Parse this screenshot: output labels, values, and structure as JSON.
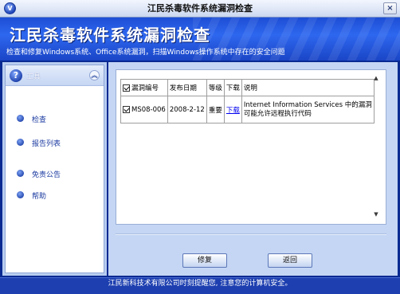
{
  "window": {
    "title": "江民杀毒软件系统漏洞检查",
    "close_glyph": "×",
    "app_icon_glyph": "V"
  },
  "banner": {
    "title": "江民杀毒软件系统漏洞检查",
    "subtitle": "检查和修复Windows系统、Office系统漏洞，扫描Windows操作系统中存在的安全问题"
  },
  "sidebar": {
    "header_label": "工具",
    "help_glyph": "?",
    "collapse_glyph": "︽",
    "items": [
      {
        "label": "检查"
      },
      {
        "label": "报告列表"
      },
      {
        "label": "免责公告"
      },
      {
        "label": "帮助"
      }
    ]
  },
  "table": {
    "columns": [
      "漏洞编号",
      "发布日期",
      "等级",
      "下载",
      "说明"
    ],
    "rows": [
      {
        "id": "MS08-006",
        "date": "2008-2-12",
        "level": "重要",
        "download": "下载",
        "description": "Internet Information Services 中的漏洞可能允许远程执行代码",
        "checked": true
      }
    ]
  },
  "buttons": {
    "repair": "修复",
    "back": "返回"
  },
  "status": {
    "text": "江民新科技术有限公司时刻提醒您, 注意您的计算机安全。"
  }
}
